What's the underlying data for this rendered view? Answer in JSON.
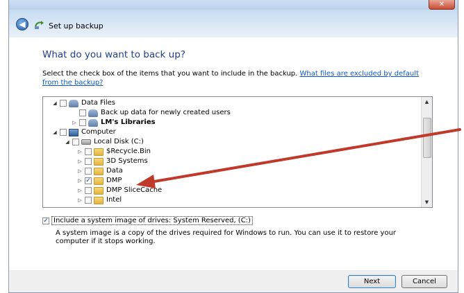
{
  "window": {
    "close_glyph": "✕"
  },
  "nav": {
    "back_glyph": "◀",
    "title": "Set up backup"
  },
  "main": {
    "heading": "What do you want to back up?",
    "intro_text": "Select the check box of the items that you want to include in the backup. ",
    "intro_link": "What files are excluded by default from the backup?"
  },
  "tree": {
    "items": [
      {
        "label": "Data Files",
        "icon": "users-icon",
        "checked": false,
        "expander": "◢",
        "bold": false
      },
      {
        "label": "Back up data for newly created users",
        "icon": "users-icon",
        "checked": false,
        "expander": "",
        "bold": false
      },
      {
        "label": "LM's Libraries",
        "icon": "users-icon",
        "checked": false,
        "expander": "▷",
        "bold": true
      },
      {
        "label": "Computer",
        "icon": "computer-icon",
        "checked": false,
        "expander": "◢",
        "bold": false
      },
      {
        "label": "Local Disk (C:)",
        "icon": "drive-icon",
        "checked": false,
        "expander": "◢",
        "bold": false
      },
      {
        "label": "$Recycle.Bin",
        "icon": "folder-icon",
        "checked": false,
        "expander": "▷",
        "bold": false
      },
      {
        "label": "3D Systems",
        "icon": "folder-icon",
        "checked": false,
        "expander": "▷",
        "bold": false
      },
      {
        "label": "Data",
        "icon": "folder-icon",
        "checked": false,
        "expander": "▷",
        "bold": false
      },
      {
        "label": "DMP",
        "icon": "folder-icon",
        "checked": true,
        "expander": "▷",
        "bold": false
      },
      {
        "label": "DMP SliceCache",
        "icon": "folder-icon",
        "checked": false,
        "expander": "▷",
        "bold": false
      },
      {
        "label": "Intel",
        "icon": "folder-icon",
        "checked": false,
        "expander": "▷",
        "bold": false
      }
    ],
    "scroll_up_glyph": "▲",
    "scroll_down_glyph": "▼"
  },
  "system_image": {
    "checked": true,
    "check_glyph": "✓",
    "label": "Include a system image of drives: System Reserved, (C:)",
    "description": "A system image is a copy of the drives required for Windows to run. You can use it to restore your computer if it stops working."
  },
  "buttons": {
    "next": "Next",
    "cancel": "Cancel"
  },
  "annotation": {
    "arrow_color": "#c0392b"
  }
}
